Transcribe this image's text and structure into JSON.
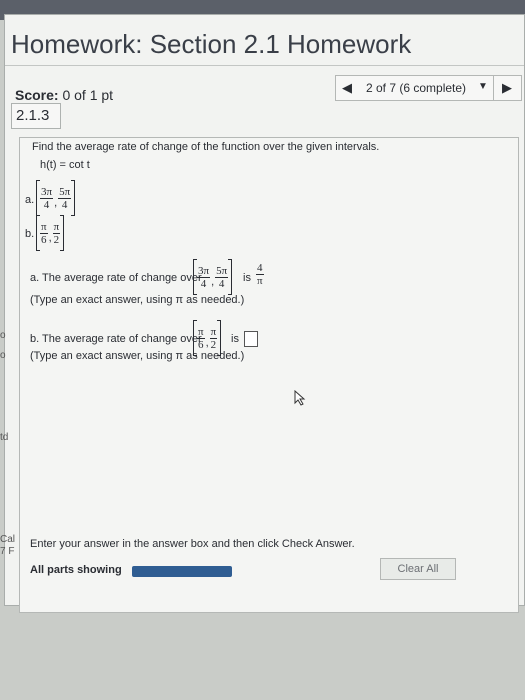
{
  "top_strip": "",
  "page_title": "Homework: Section 2.1 Homework",
  "score": {
    "label": "Score:",
    "value": "0 of 1 pt"
  },
  "nav": {
    "position": "2 of 7 (6 complete)",
    "prev": "◀",
    "next": "▶",
    "dropdown": "▼"
  },
  "question_number": "2.1.3",
  "prompt": "Find the average rate of change of the function over the given intervals.",
  "function": "h(t) = cot t",
  "parts": {
    "a_label": "a.",
    "a_interval": {
      "left": {
        "num": "3π",
        "den": "4"
      },
      "right": {
        "num": "5π",
        "den": "4"
      }
    },
    "b_label": "b.",
    "b_interval": {
      "left": {
        "num": "π",
        "den": "6"
      },
      "right": {
        "num": "π",
        "den": "2"
      }
    }
  },
  "answer_a": {
    "text": "a. The average rate of change over",
    "is": "is",
    "result": {
      "num": "4",
      "den": "π"
    },
    "hint": "(Type an exact answer, using π as needed.)"
  },
  "answer_b": {
    "text": "b. The average rate of change over",
    "is": "is",
    "hint": "(Type an exact answer, using π as needed.)"
  },
  "side_cut": {
    "o1": "o",
    "o2": "o",
    "td": "td",
    "cal": "Cal",
    "num": "7 F"
  },
  "bottom_message": "Enter your answer in the answer box and then click Check Answer.",
  "parts_showing": "All parts showing",
  "clear_all": "Clear All"
}
